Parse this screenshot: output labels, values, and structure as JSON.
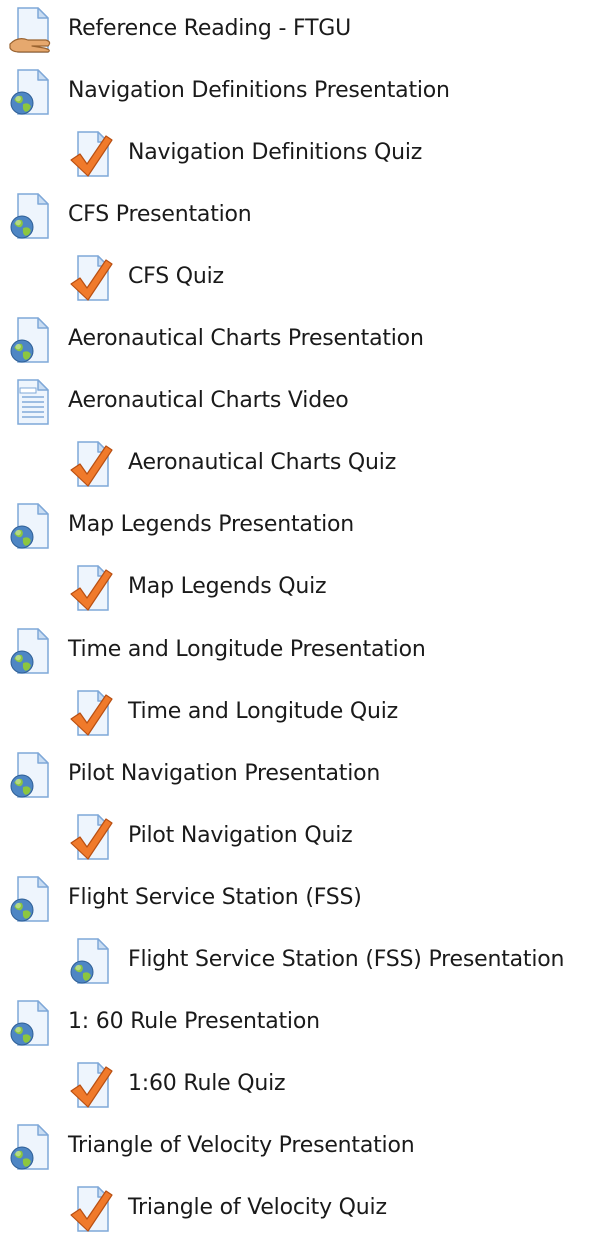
{
  "activities": [
    {
      "label": "Reference Reading - FTGU",
      "type": "resource",
      "icon": "hand-page-icon",
      "indent": false
    },
    {
      "label": "Navigation Definitions Presentation",
      "type": "url",
      "icon": "globe-page-icon",
      "indent": false
    },
    {
      "label": "Navigation Definitions Quiz",
      "type": "quiz",
      "icon": "quiz-checkmark-icon",
      "indent": true
    },
    {
      "label": "CFS Presentation",
      "type": "url",
      "icon": "globe-page-icon",
      "indent": false
    },
    {
      "label": "CFS Quiz",
      "type": "quiz",
      "icon": "quiz-checkmark-icon",
      "indent": true
    },
    {
      "label": "Aeronautical Charts Presentation",
      "type": "url",
      "icon": "globe-page-icon",
      "indent": false
    },
    {
      "label": "Aeronautical Charts Video",
      "type": "page",
      "icon": "document-page-icon",
      "indent": false
    },
    {
      "label": "Aeronautical Charts Quiz",
      "type": "quiz",
      "icon": "quiz-checkmark-icon",
      "indent": true
    },
    {
      "label": "Map Legends Presentation",
      "type": "url",
      "icon": "globe-page-icon",
      "indent": false
    },
    {
      "label": "Map Legends Quiz",
      "type": "quiz",
      "icon": "quiz-checkmark-icon",
      "indent": true
    },
    {
      "label": "Time and Longitude Presentation",
      "type": "url",
      "icon": "globe-page-icon",
      "indent": false
    },
    {
      "label": "Time and Longitude Quiz",
      "type": "quiz",
      "icon": "quiz-checkmark-icon",
      "indent": true
    },
    {
      "label": "Pilot Navigation Presentation",
      "type": "url",
      "icon": "globe-page-icon",
      "indent": false
    },
    {
      "label": "Pilot Navigation Quiz",
      "type": "quiz",
      "icon": "quiz-checkmark-icon",
      "indent": true
    },
    {
      "label": "Flight Service Station (FSS)",
      "type": "url",
      "icon": "globe-page-icon",
      "indent": false
    },
    {
      "label": "Flight Service Station (FSS) Presentation",
      "type": "url",
      "icon": "globe-icon",
      "indent": true
    },
    {
      "label": "1: 60 Rule Presentation",
      "type": "url",
      "icon": "globe-page-icon",
      "indent": false
    },
    {
      "label": "1:60 Rule Quiz",
      "type": "quiz",
      "icon": "quiz-checkmark-icon",
      "indent": true
    },
    {
      "label": "Triangle of Velocity Presentation",
      "type": "url",
      "icon": "globe-page-icon",
      "indent": false
    },
    {
      "label": "Triangle of Velocity Quiz",
      "type": "quiz",
      "icon": "quiz-checkmark-icon",
      "indent": true
    }
  ]
}
